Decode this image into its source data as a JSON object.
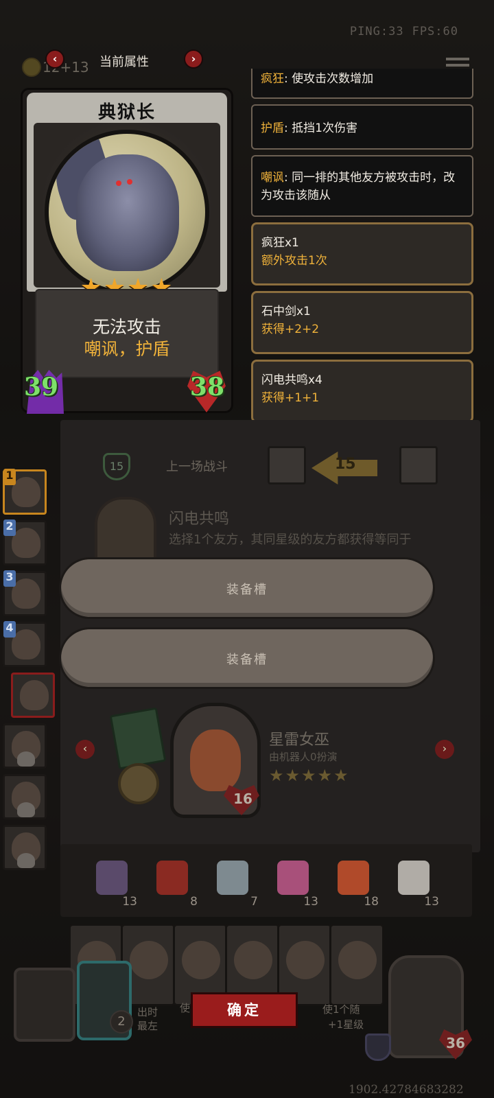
{
  "hud": {
    "ping": "PING:33",
    "fps": "FPS:60",
    "coins": "12+13"
  },
  "attribute_panel": {
    "title": "当前属性",
    "prev_icon": "‹",
    "next_icon": "›"
  },
  "hero": {
    "name": "典狱长",
    "stars": 4,
    "star_glyph": "★",
    "description": "无法攻击",
    "keywords": "嘲讽，护盾",
    "attack": "39",
    "health": "38"
  },
  "effects": [
    {
      "keyword": "疯狂",
      "text": ": 使攻击次数增加"
    },
    {
      "keyword": "护盾",
      "text": ": 抵挡1次伤害"
    },
    {
      "keyword": "嘲讽",
      "text": ": 同一排的其他友方被攻击时，改为攻击该随从"
    }
  ],
  "buffs": [
    {
      "name": "疯狂x1",
      "value": "额外攻击1次"
    },
    {
      "name": "石中剑x1",
      "value": "获得+2+2"
    },
    {
      "name": "闪电共鸣x4",
      "value": "获得+1+1"
    }
  ],
  "last_battle": {
    "label": "上一场战斗",
    "shield_value": "15",
    "arrow_value": "15"
  },
  "spell": {
    "title": "闪电共鸣",
    "desc": "选择1个友方，其同星级的友方都获得等同于"
  },
  "equip_slots": [
    {
      "label": "装备槽"
    },
    {
      "label": "装备槽"
    }
  ],
  "party": [
    {
      "num": "1"
    },
    {
      "num": "2"
    },
    {
      "num": "3"
    },
    {
      "num": "4"
    }
  ],
  "witch": {
    "name": "星雷女巫",
    "subtitle": "由机器人0扮演",
    "stars": "★★★★★",
    "hp": "16"
  },
  "items": [
    {
      "icon": "mirror-icon",
      "count": "13",
      "color": "#5a4a6a"
    },
    {
      "icon": "alarm-clock-icon",
      "count": "8",
      "color": "#8a2a22"
    },
    {
      "icon": "teacup-icon",
      "count": "7",
      "color": "#7e8a90"
    },
    {
      "icon": "cupcake-icon",
      "count": "13",
      "color": "#a8507a"
    },
    {
      "icon": "fish-icon",
      "count": "18",
      "color": "#b04a2a"
    },
    {
      "icon": "clown-icon",
      "count": "13",
      "color": "#b0aca6"
    }
  ],
  "bottom": {
    "confirm_label": "确定",
    "left_card_count": "2",
    "frag1": "出时",
    "frag2": "最左",
    "frag3": "使",
    "frag4": "使1个随",
    "frag5": "+1星级",
    "right_hp": "36",
    "coordinate": "1902.42784683282"
  },
  "colors": {
    "accent_gold": "#f0b23a",
    "stat_green": "#7ee06a",
    "confirm_red": "#9a1c1c"
  }
}
